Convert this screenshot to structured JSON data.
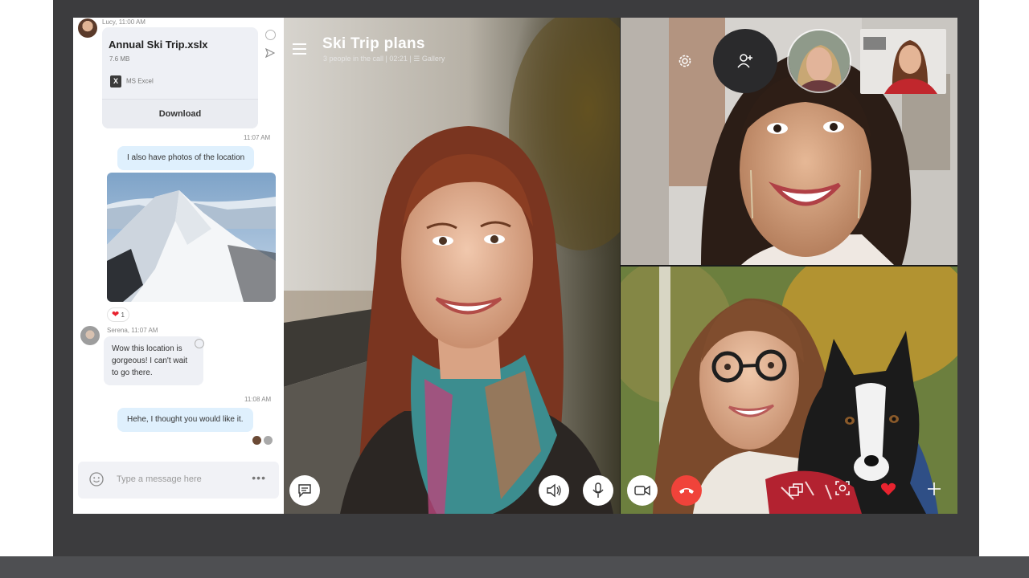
{
  "chat": {
    "messages": {
      "lucy_meta": "Lucy, 11:00 AM",
      "file_name": "Annual Ski Trip.xslx",
      "file_size": "7.6 MB",
      "file_type": "MS Excel",
      "download_label": "Download",
      "time_1": "11:07 AM",
      "photos_text": "I also have photos of the location",
      "reaction_count": "1",
      "serena_meta": "Serena, 11:07 AM",
      "serena_text": "Wow this location is gorgeous! I can't wait to go there.",
      "time_2": "11:08 AM",
      "reply_text": "Hehe, I thought you would like it."
    },
    "composer": {
      "placeholder": "Type a message here",
      "more_label": "•••"
    },
    "icons": [
      "emoji-icon",
      "forward-icon",
      "excel-icon",
      "heart-icon",
      "smiley-icon",
      "more-icon"
    ]
  },
  "call": {
    "title": "Ski Trip plans",
    "subtitle": "3 people in the call | 02:21  |  ☰ Gallery",
    "controls": [
      "chat-icon",
      "speaker-icon",
      "microphone-icon",
      "video-camera-icon",
      "end-call-icon",
      "screen-share-icon",
      "snapshot-icon",
      "heart-reaction-icon",
      "add-icon",
      "settings-icon",
      "add-person-icon",
      "menu-icon"
    ]
  },
  "colors": {
    "bezel": "#3c3c3e",
    "chat_bg": "#ffffff",
    "bubble_out": "#dff0fd",
    "bubble_in": "#eef0f5",
    "end_call": "#f0433a",
    "heart": "#e8232f"
  }
}
